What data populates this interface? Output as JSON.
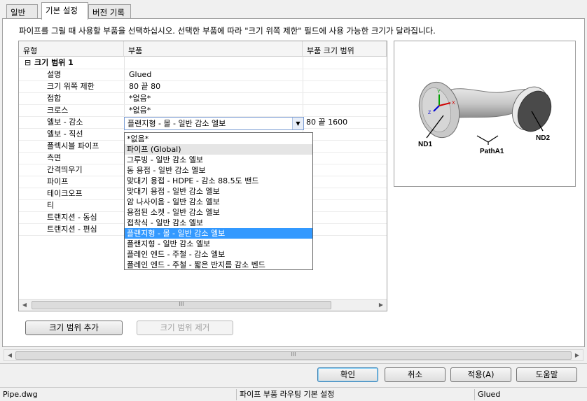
{
  "tabs": [
    {
      "label": "일반"
    },
    {
      "label": "기본 설정"
    },
    {
      "label": "버전 기록"
    }
  ],
  "instruction": "파이프를 그릴 때 사용할 부품을 선택하십시오. 선택한 부품에 따라 \"크기 위쪽 제한\" 필드에 사용 가능한 크기가 달라집니다.",
  "grid": {
    "columns": [
      "유형",
      "부품",
      "부품 크기 범위"
    ],
    "group_label": "크기 범위 1",
    "group_toggle": "⊟",
    "rows": [
      {
        "type": "설명",
        "part": "Glued",
        "range": ""
      },
      {
        "type": "크기 위쪽 제한",
        "part": "80 끝 80",
        "range": ""
      },
      {
        "type": "접합",
        "part": "*없음*",
        "range": ""
      },
      {
        "type": "크로스",
        "part": "*없음*",
        "range": ""
      },
      {
        "type": "엘보 - 감소",
        "part": "플랜지형 - 몰 - 일반 감소 엘보",
        "range": "80 끝 1600"
      },
      {
        "type": "엘보 - 직선",
        "part": "",
        "range": ""
      },
      {
        "type": "플렉시블 파이프",
        "part": "",
        "range": ""
      },
      {
        "type": "측면",
        "part": "",
        "range": ""
      },
      {
        "type": "간격띄우기",
        "part": "",
        "range": ""
      },
      {
        "type": "파이프",
        "part": "",
        "range": ""
      },
      {
        "type": "테이크오프",
        "part": "",
        "range": ""
      },
      {
        "type": "티",
        "part": "",
        "range": ""
      },
      {
        "type": "트랜지션 - 동심",
        "part": "",
        "range": ""
      },
      {
        "type": "트랜지션 - 편심",
        "part": "",
        "range": ""
      }
    ]
  },
  "dropdown": {
    "options": [
      "*없음*",
      "파이프 (Global)",
      "그루빙 - 일반 감소 엘보",
      "동 용접 - 일반 감소 엘보",
      "맞대기 용접 - HDPE - 감소 88.5도 밴드",
      "맞대기 용접 - 일반 감소 엘보",
      "암 나사이음 - 일반 감소 엘보",
      "용접된 소켓 - 일반 감소 엘보",
      "접착식 - 일반 감소 엘보",
      "플랜지형 - 몰 - 일반 감소 엘보",
      "플랜지형 - 일반 감소 엘보",
      "플레인 엔드 - 주철 - 감소 엘보",
      "플레인 엔드 - 주철 - 짧은 반지름 감소 벤드"
    ],
    "selected_index": 9,
    "hover_index": 1
  },
  "preview": {
    "labels": {
      "nd1": "ND1",
      "nd2": "ND2",
      "path": "PathA1"
    },
    "axis_labels": {
      "x": "X",
      "y": "Y",
      "z": "Z"
    }
  },
  "buttons": {
    "add_range": "크기 범위 추가",
    "remove_range": "크기 범위 제거",
    "ok": "확인",
    "cancel": "취소",
    "apply": "적용(A)",
    "help": "도움말"
  },
  "scroll_thumb_grip": "III",
  "status": {
    "file": "Pipe.dwg",
    "title": "파이프 부품 라우팅 기본 설정",
    "value": "Glued"
  },
  "colors": {
    "selection": "#3399ff",
    "default_button_border": "#3c7fb1"
  }
}
